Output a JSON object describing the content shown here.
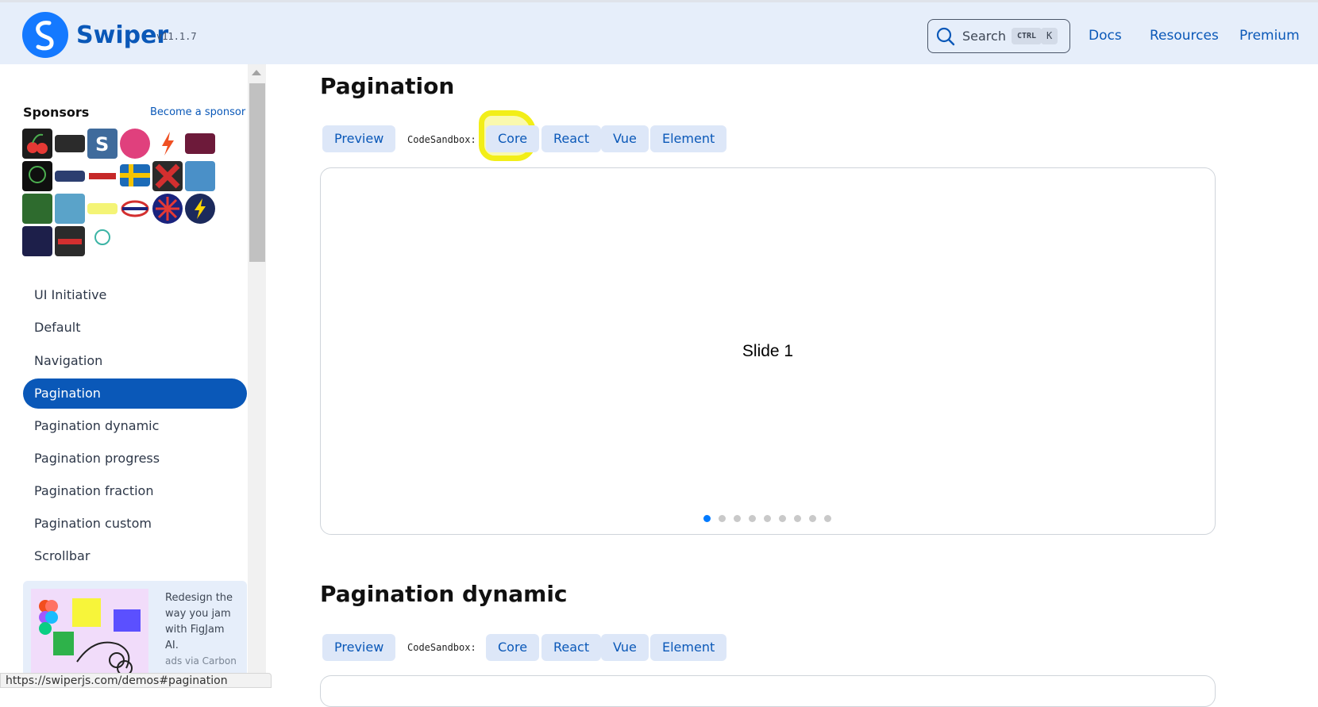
{
  "header": {
    "brand": "Swiper",
    "version": "v11.1.7",
    "search": {
      "label": "Search",
      "kbd_ctrl": "CTRL",
      "kbd_k": "K"
    },
    "nav": [
      "Docs",
      "Resources",
      "Premium"
    ]
  },
  "sidebar": {
    "sponsors_title": "Sponsors",
    "become_sponsor": "Become a sponsor",
    "items": [
      {
        "label": "UI Initiative"
      },
      {
        "label": "Default"
      },
      {
        "label": "Navigation"
      },
      {
        "label": "Pagination",
        "active": true
      },
      {
        "label": "Pagination dynamic"
      },
      {
        "label": "Pagination progress"
      },
      {
        "label": "Pagination fraction"
      },
      {
        "label": "Pagination custom"
      },
      {
        "label": "Scrollbar"
      }
    ],
    "ad": {
      "text": "Redesign the way you jam with FigJam AI.",
      "via": "ads via Carbon"
    },
    "status_url": "https://swiperjs.com/demos#pagination"
  },
  "sections": [
    {
      "title": "Pagination",
      "preview": "Preview",
      "codesandbox_label": "CodeSandbox:",
      "links": [
        "Core",
        "React",
        "Vue",
        "Element"
      ],
      "slide_label": "Slide 1",
      "dots_total": 9,
      "dots_active": 1
    },
    {
      "title": "Pagination dynamic",
      "preview": "Preview",
      "codesandbox_label": "CodeSandbox:",
      "links": [
        "Core",
        "React",
        "Vue",
        "Element"
      ]
    }
  ],
  "colors": {
    "brand": "#0a58b8",
    "header_bg": "#e6eefa",
    "button_bg": "#dde7f8",
    "dot_active": "#007aff",
    "highlight": "#f2ee18"
  }
}
